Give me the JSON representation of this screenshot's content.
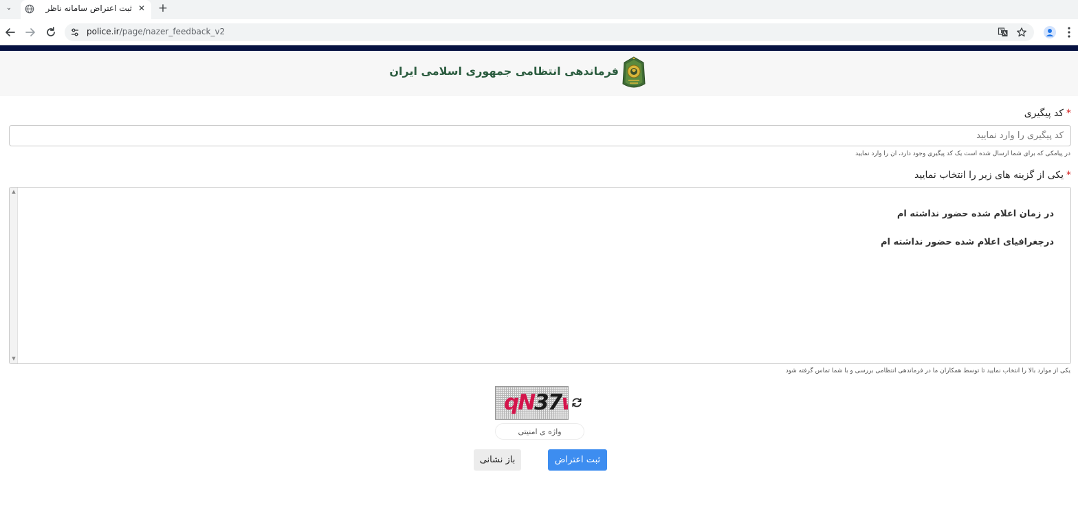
{
  "browser": {
    "tab": {
      "title": "ثبت اعتراض سامانه ناظر",
      "favicon": "globe-icon"
    },
    "url": {
      "host": "police.ir",
      "path": "/page/nazer_feedback_v2"
    }
  },
  "header": {
    "title": "فرماندهی انتظامی جمهوری اسلامی ایران",
    "emblem": "police-emblem",
    "colors": {
      "topbar": "#061141",
      "title": "#2b5c3f"
    }
  },
  "tracking": {
    "label": "کد پیگیری",
    "required_mark": "*",
    "placeholder": "کد پیگیری را وارد نمایید",
    "value": "",
    "help": "در پیامکی که برای شما ارسال شده است یک کد پیگیری وجود دارد، ان را وارد نمایید"
  },
  "options": {
    "label": "یکی از گزینه های زیر را انتخاب نمایید",
    "required_mark": "*",
    "items": [
      {
        "label": "در زمان اعلام شده حضور نداشته ام"
      },
      {
        "label": "درجغرافیای اعلام شده حضور نداشته ام"
      }
    ],
    "help": "یکی از موارد بالا را انتخاب نمایید تا توسط همکاران ما در فرماندهی انتظامی بررسی و با شما تماس گرفته شود"
  },
  "captcha": {
    "text_part1": "qN",
    "text_part2": "37",
    "text_part3": "w",
    "placeholder": "واژه ی امنیتی",
    "value": ""
  },
  "actions": {
    "submit_label": "ثبت اعتراض",
    "reset_label": "باز نشانی",
    "submit_color": "#3d8df0"
  }
}
